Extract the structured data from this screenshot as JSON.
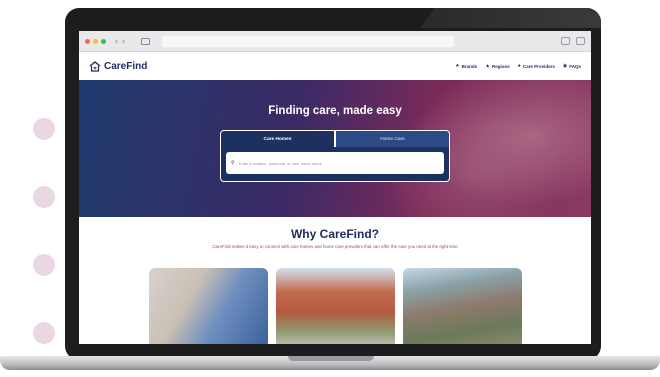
{
  "site": {
    "logo_text": "CareFind",
    "nav": [
      {
        "label": "Brands",
        "icon": "star-icon"
      },
      {
        "label": "Regions",
        "icon": "map-icon"
      },
      {
        "label": "Care Providers",
        "icon": "people-icon"
      },
      {
        "label": "FAQs",
        "icon": "info-icon"
      }
    ]
  },
  "hero": {
    "title": "Finding care, made easy",
    "tabs": [
      {
        "label": "Care Homes",
        "active": true
      },
      {
        "label": "Home Care",
        "active": false
      }
    ],
    "search_placeholder": "Enter a location, postcode, or care home name"
  },
  "why": {
    "title": "Why CareFind?",
    "subtitle": "CareFind makes it easy to connect with care homes and home care providers that can offer the care you need at the right time"
  },
  "colors": {
    "brand_navy": "#1f2a5e",
    "accent_pink": "#b53a77",
    "hero_gradient_start": "#1e3a6e",
    "hero_gradient_end": "#8a3a62"
  }
}
